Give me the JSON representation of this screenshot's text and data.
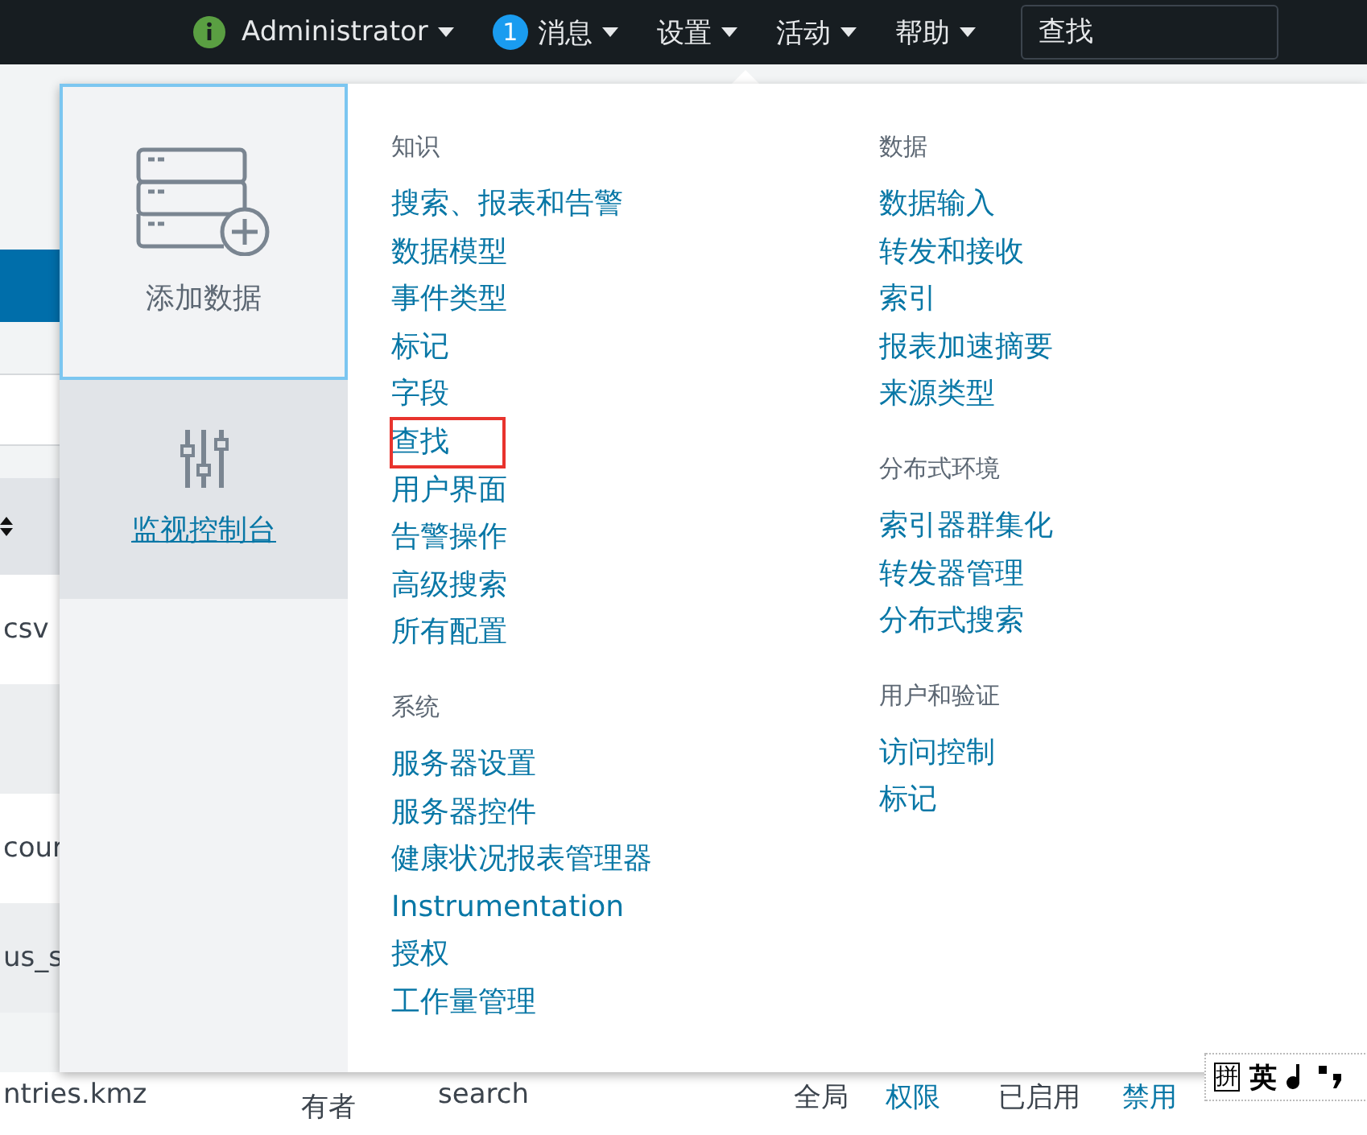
{
  "top_bar": {
    "items": [
      {
        "kind": "user",
        "label": "Administrator"
      },
      {
        "kind": "messages",
        "badge": "1",
        "label": "消息"
      },
      {
        "kind": "menu",
        "label": "设置"
      },
      {
        "kind": "menu",
        "label": "活动"
      },
      {
        "kind": "menu",
        "label": "帮助"
      }
    ],
    "search": {
      "placeholder": "查找"
    }
  },
  "background_table": {
    "rows": [
      {
        "cell": "csv",
        "shaded": false
      },
      {
        "cell": "",
        "shaded": true
      },
      {
        "cell": "cour",
        "shaded": false
      },
      {
        "cell": "us_s",
        "shaded": true
      }
    ],
    "last_row": {
      "file": "ntries.kmz",
      "owner": "有者",
      "app": "search",
      "sharing": [
        "全局",
        "权限"
      ],
      "status": [
        "已启用",
        "禁用"
      ]
    }
  },
  "dropdown": {
    "tiles": [
      {
        "kind": "add-data",
        "label": "添加数据",
        "selected": true
      },
      {
        "kind": "monitoring",
        "label": "监视控制台",
        "selected": false
      }
    ],
    "columns": [
      {
        "groups": [
          {
            "heading": "知识",
            "items": [
              {
                "label": "搜索、报表和告警",
                "highlighted": false
              },
              {
                "label": "数据模型",
                "highlighted": false
              },
              {
                "label": "事件类型",
                "highlighted": false
              },
              {
                "label": "标记",
                "highlighted": false
              },
              {
                "label": "字段",
                "highlighted": false
              },
              {
                "label": "查找",
                "highlighted": true
              },
              {
                "label": "用户界面",
                "highlighted": false
              },
              {
                "label": "告警操作",
                "highlighted": false
              },
              {
                "label": "高级搜索",
                "highlighted": false
              },
              {
                "label": "所有配置",
                "highlighted": false
              }
            ]
          },
          {
            "heading": "系统",
            "items": [
              {
                "label": "服务器设置",
                "highlighted": false
              },
              {
                "label": "服务器控件",
                "highlighted": false
              },
              {
                "label": "健康状况报表管理器",
                "highlighted": false
              },
              {
                "label": "Instrumentation",
                "highlighted": false
              },
              {
                "label": "授权",
                "highlighted": false
              },
              {
                "label": "工作量管理",
                "highlighted": false
              }
            ]
          }
        ]
      },
      {
        "groups": [
          {
            "heading": "数据",
            "items": [
              {
                "label": "数据输入",
                "highlighted": false
              },
              {
                "label": "转发和接收",
                "highlighted": false
              },
              {
                "label": "索引",
                "highlighted": false
              },
              {
                "label": "报表加速摘要",
                "highlighted": false
              },
              {
                "label": "来源类型",
                "highlighted": false
              }
            ]
          },
          {
            "heading": "分布式环境",
            "items": [
              {
                "label": "索引器群集化",
                "highlighted": false
              },
              {
                "label": "转发器管理",
                "highlighted": false
              },
              {
                "label": "分布式搜索",
                "highlighted": false
              }
            ]
          },
          {
            "heading": "用户和验证",
            "items": [
              {
                "label": "访问控制",
                "highlighted": false
              },
              {
                "label": "标记",
                "highlighted": false
              }
            ]
          }
        ]
      }
    ]
  },
  "ime_bar": {
    "items": [
      "拼",
      "英"
    ]
  }
}
